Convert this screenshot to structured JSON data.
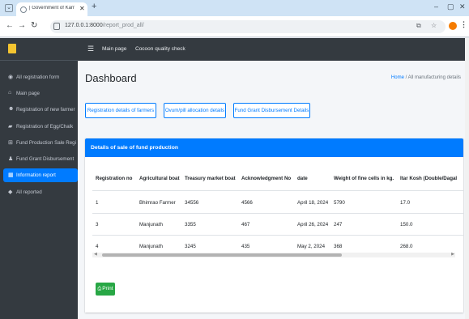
{
  "browser": {
    "tab_title": "| Government of Karnataka Silk",
    "tab_close": "✕",
    "new_tab": "+",
    "url_host": "127.0.0.1:8000",
    "url_path": "/report_prod_all/",
    "window_minimize": "–",
    "window_restore": "▢",
    "window_close": "✕"
  },
  "topnav": {
    "links": [
      "Main page",
      "Cocoon quality check"
    ]
  },
  "sidebar": {
    "items": [
      {
        "label": "All registration form",
        "icon": "gauge-icon",
        "active": false
      },
      {
        "label": "Main page",
        "icon": "home-icon",
        "active": false
      },
      {
        "label": "Registration of new farmer",
        "icon": "user-circle-icon",
        "active": false
      },
      {
        "label": "Registration of Egg/Chalk",
        "icon": "truck-icon",
        "active": false
      },
      {
        "label": "Fund Production Sale Regi",
        "icon": "cart-icon",
        "active": false
      },
      {
        "label": "Fund Grant Disbursement",
        "icon": "person-icon",
        "active": false
      },
      {
        "label": "Information report",
        "icon": "table-icon",
        "active": true
      },
      {
        "label": "All reported",
        "icon": "tag-icon",
        "active": false
      }
    ]
  },
  "page": {
    "title": "Dashboard",
    "breadcrumb_home": "Home",
    "breadcrumb_sep": "/",
    "breadcrumb_current": "All manufacturing details"
  },
  "action_buttons": [
    "Registration details of farmers",
    "Ovum/pill allocation details",
    "Fund Grant Disbursement Details"
  ],
  "card": {
    "title": "Details of sale of fund production",
    "columns": [
      "Registration no",
      "Agricultural boat",
      "Treasury market boat",
      "Acknowledgment No",
      "date",
      "Weight of fine cells in kg.",
      "Itar Kosh (Double/Dagal"
    ],
    "rows": [
      [
        "1",
        "Bhimrao Farmer",
        "34556",
        "4566",
        "April 18, 2024",
        "5790",
        "17.0"
      ],
      [
        "3",
        "Manjunath",
        "3355",
        "467",
        "April 26, 2024",
        "247",
        "150.0"
      ],
      [
        "4",
        "Manjunath",
        "3245",
        "435",
        "May 2, 2024",
        "368",
        "268.0"
      ]
    ],
    "print_label": "Print"
  },
  "colors": {
    "primary": "#007bff",
    "success": "#28a745",
    "sidebar_bg": "#343a40"
  }
}
